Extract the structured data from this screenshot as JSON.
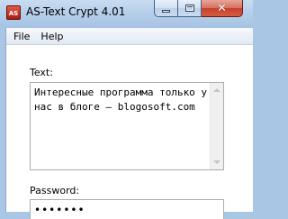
{
  "window": {
    "title": "AS-Text Crypt 4.01",
    "icon_text": "AS"
  },
  "caption_buttons": {
    "minimize_icon": "minimize-icon",
    "maximize_icon": "maximize-icon",
    "close_icon": "close-icon",
    "close_glyph": "✕"
  },
  "menu": {
    "items": [
      {
        "label": "File"
      },
      {
        "label": "Help"
      }
    ]
  },
  "form": {
    "text_label": "Text:",
    "text_value": "Интересные программа только у нас в блоге – blogosoft.com",
    "password_label": "Password:",
    "password_mask": "•••••••"
  },
  "colors": {
    "titlebar": "#b6cfea",
    "close_button": "#c6402b",
    "background": "#ffffff"
  }
}
